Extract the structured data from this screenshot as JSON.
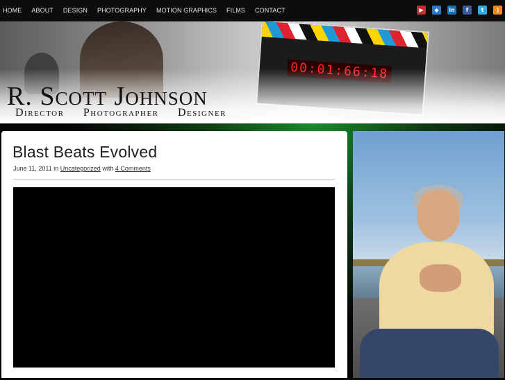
{
  "nav": {
    "items": [
      "HOME",
      "ABOUT",
      "DESIGN",
      "PHOTOGRAPHY",
      "MOTION GRAPHICS",
      "FILMS",
      "CONTACT"
    ]
  },
  "social": {
    "icons": [
      "youtube-icon",
      "delicious-icon",
      "linkedin-icon",
      "facebook-icon",
      "twitter-icon",
      "rss-icon"
    ]
  },
  "header": {
    "site_title": "R. Scott Johnson",
    "tagline": "Director Photographer Designer",
    "slate_clock": "00:01:66:18"
  },
  "post": {
    "title": "Blast Beats Evolved",
    "date": "June 11, 2011",
    "in_text": "in",
    "category": "Uncategorized",
    "with_text": "with",
    "comments": "4 Comments"
  },
  "colors": {
    "nav_bg": "#0c0c0c",
    "accent_glow": "#1a8a2a",
    "card_bg": "#ffffff"
  }
}
